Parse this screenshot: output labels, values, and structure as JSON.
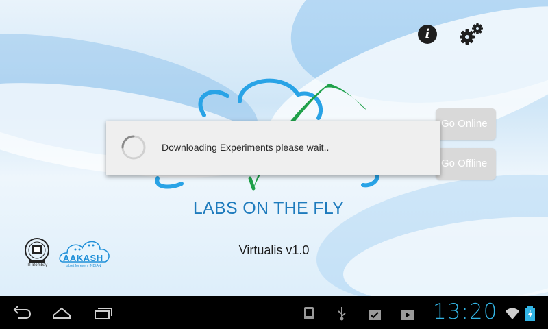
{
  "app": {
    "title": "LABS ON THE FLY",
    "version": "Virtualis v1.0",
    "buttons": {
      "go_online": "Go Online",
      "go_offline": "Go Offline"
    },
    "toolbar_icons": [
      "info-icon",
      "settings-gear-icon"
    ]
  },
  "dialog": {
    "message": "Downloading Experiments please wait.."
  },
  "logos": {
    "iitb_caption": "IIT Bombay",
    "aakash_word": "AAKASH",
    "aakash_tagline": "tablet for every INDIAN"
  },
  "system_bar": {
    "time": "13:20",
    "nav_icons": [
      "back-icon",
      "home-icon",
      "recent-apps-icon"
    ],
    "status_icons": [
      "android-debug-icon",
      "usb-icon",
      "download-complete-icon",
      "play-store-icon",
      "wifi-icon",
      "battery-charging-icon"
    ]
  },
  "colors": {
    "title_blue": "#1e7bbd",
    "cloud_blue": "#29a3e6",
    "leaf_green": "#1fa14a",
    "clock_blue": "#33b5e5",
    "button_gray": "#d9d9d9"
  }
}
